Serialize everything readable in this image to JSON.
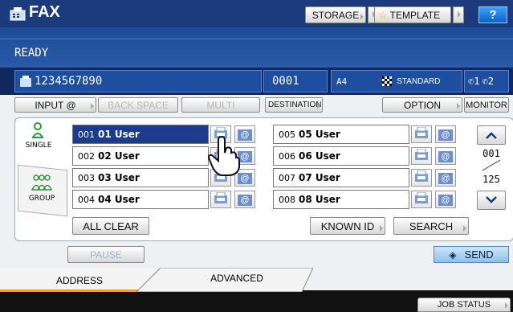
{
  "header": {
    "title": "FAX",
    "storage": "STORAGE",
    "template": "TEMPLATE",
    "help": "?"
  },
  "status": {
    "ready": "READY"
  },
  "info": {
    "fax_number": "1234567890",
    "count": "0001",
    "paper": "A4",
    "resolution": "STANDARD",
    "line1": "1",
    "line2": "2"
  },
  "toolbar": {
    "input": "INPUT @",
    "backspace": "BACK SPACE",
    "multi": "MULTI",
    "destination": "DESTINATION",
    "option": "OPTION",
    "monitor": "MONITOR"
  },
  "side_tabs": {
    "single": "SINGLE",
    "group": "GROUP"
  },
  "entries": [
    {
      "num": "001",
      "name": "01 User"
    },
    {
      "num": "002",
      "name": "02 User"
    },
    {
      "num": "003",
      "name": "03 User"
    },
    {
      "num": "004",
      "name": "04 User"
    },
    {
      "num": "005",
      "name": "05 User"
    },
    {
      "num": "006",
      "name": "06 User"
    },
    {
      "num": "007",
      "name": "07 User"
    },
    {
      "num": "008",
      "name": "08 User"
    }
  ],
  "pager": {
    "current": "001",
    "total": "125"
  },
  "actions": {
    "all_clear": "ALL CLEAR",
    "known_id": "KNOWN ID",
    "search": "SEARCH",
    "pause": "PAUSE",
    "send": "SEND"
  },
  "bottom_tabs": {
    "address": "ADDRESS",
    "advanced": "ADVANCED"
  },
  "footer": {
    "job_status": "JOB STATUS"
  },
  "colors": {
    "header": "#1c3b7c",
    "selected": "#1c3b8c",
    "send": "#9ec8ec",
    "tab_accent": "#f4a21a"
  }
}
